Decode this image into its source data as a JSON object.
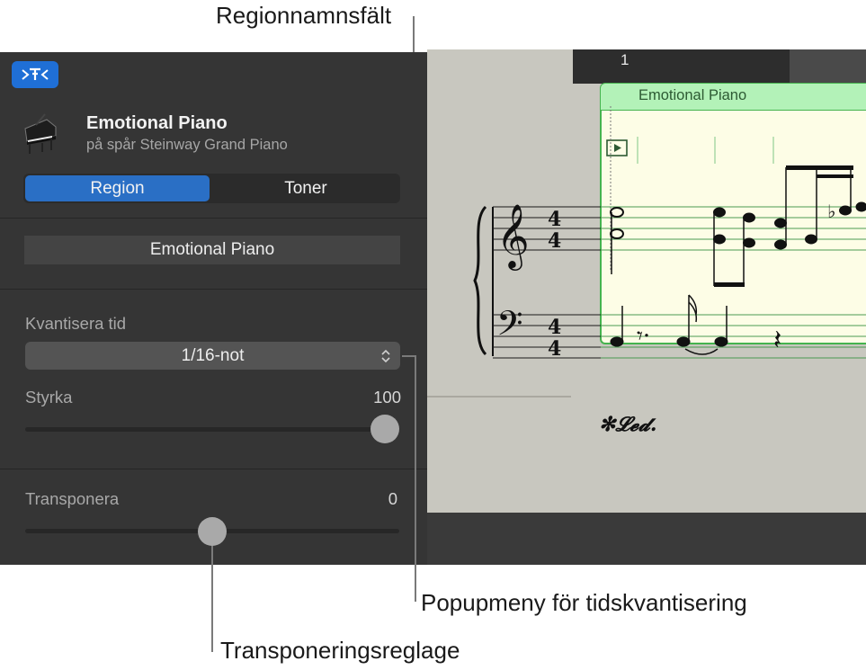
{
  "callouts": {
    "region_name_field": "Regionnamnsfält",
    "quantize_popup": "Popupmeny för tidskvantisering",
    "transpose_slider": "Transponeringsreglage"
  },
  "inspector": {
    "toolbar_button_icon": "smart-controls-icon",
    "instrument_icon": "grand-piano-icon",
    "region_title": "Emotional Piano",
    "track_subtitle": "på spår Steinway Grand Piano",
    "segmented": {
      "region_label": "Region",
      "notes_label": "Toner",
      "selected": "Region"
    },
    "region_name_value": "Emotional Piano",
    "quantize": {
      "label": "Kvantisera tid",
      "value": "1/16-not"
    },
    "strength": {
      "label": "Styrka",
      "value": "100",
      "fraction": 1.0
    },
    "transpose": {
      "label": "Transponera",
      "value": "0",
      "fraction": 0.5
    }
  },
  "editor": {
    "bar_number": "1",
    "region_header_title": "Emotional Piano",
    "pedal_marking": "✻𝓛𝓮𝓭.",
    "time_signature_top": "4",
    "time_signature_bottom": "4",
    "colors": {
      "region_header": "#b3f2b8",
      "region_body": "#fdfde6",
      "region_border": "#45b34e",
      "accent": "#2a6fc5"
    }
  }
}
